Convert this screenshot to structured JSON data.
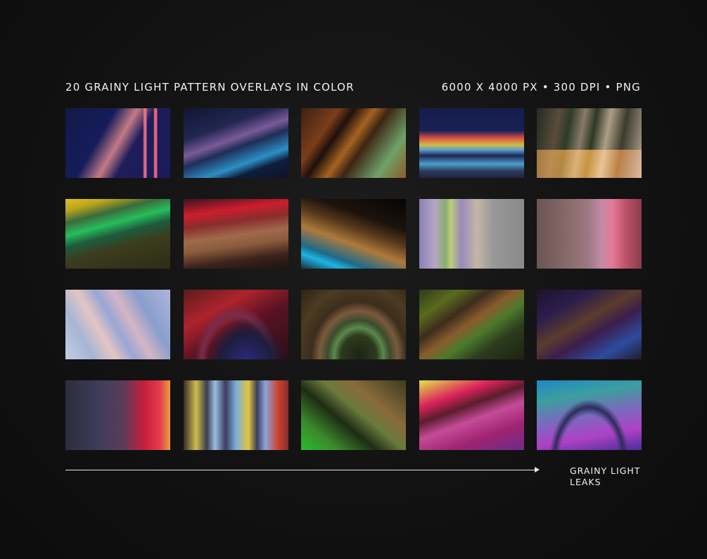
{
  "header": {
    "title": "20 GRAINY LIGHT PATTERN OVERLAYS IN COLOR",
    "specs": "6000 X 4000 PX • 300 DPI • PNG"
  },
  "footer": {
    "label_line1": "GRAINY LIGHT",
    "label_line2": "LEAKS"
  },
  "colors": {
    "background": "#121212",
    "text": "#f2f2f2"
  }
}
